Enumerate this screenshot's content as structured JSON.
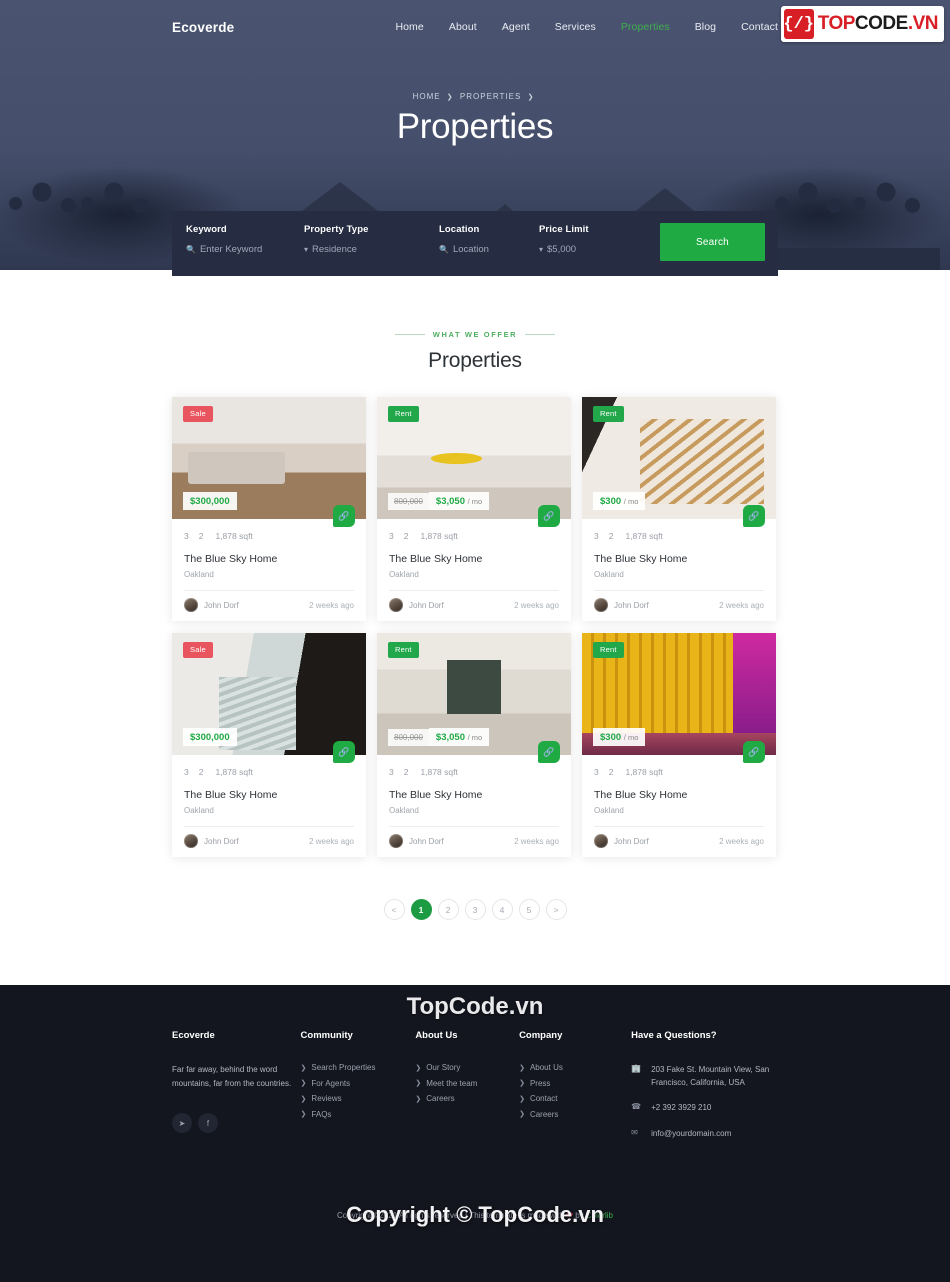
{
  "brand": "Ecoverde",
  "nav": {
    "items": [
      {
        "label": "Home",
        "active": false
      },
      {
        "label": "About",
        "active": false
      },
      {
        "label": "Agent",
        "active": false
      },
      {
        "label": "Services",
        "active": false
      },
      {
        "label": "Properties",
        "active": true
      },
      {
        "label": "Blog",
        "active": false
      },
      {
        "label": "Contact",
        "active": false
      }
    ]
  },
  "hero": {
    "breadcrumb": [
      "HOME",
      "PROPERTIES"
    ],
    "title": "Properties"
  },
  "search": {
    "keyword_label": "Keyword",
    "keyword_value": "Enter Keyword",
    "property_type_label": "Property Type",
    "property_type_value": "Residence",
    "location_label": "Location",
    "location_value": "Location",
    "price_label": "Price Limit",
    "price_value": "$5,000",
    "button": "Search"
  },
  "section": {
    "eyebrow": "WHAT WE OFFER",
    "title": "Properties"
  },
  "cards": [
    {
      "tag": "Sale",
      "tag_type": "sale",
      "price_old": "",
      "price_new": "$300,000",
      "per": "",
      "beds": "3",
      "baths": "2",
      "area": "1,878 sqft",
      "title": "The Blue Sky Home",
      "location": "Oakland",
      "author": "John Dorf",
      "ago": "2 weeks ago",
      "photo": "ph1"
    },
    {
      "tag": "Rent",
      "tag_type": "rent",
      "price_old": "800,000",
      "price_new": "$3,050",
      "per": "/ mo",
      "beds": "3",
      "baths": "2",
      "area": "1,878 sqft",
      "title": "The Blue Sky Home",
      "location": "Oakland",
      "author": "John Dorf",
      "ago": "2 weeks ago",
      "photo": "ph2"
    },
    {
      "tag": "Rent",
      "tag_type": "rent",
      "price_old": "",
      "price_new": "$300",
      "per": "/ mo",
      "beds": "3",
      "baths": "2",
      "area": "1,878 sqft",
      "title": "The Blue Sky Home",
      "location": "Oakland",
      "author": "John Dorf",
      "ago": "2 weeks ago",
      "photo": "ph3"
    },
    {
      "tag": "Sale",
      "tag_type": "sale",
      "price_old": "",
      "price_new": "$300,000",
      "per": "",
      "beds": "3",
      "baths": "2",
      "area": "1,878 sqft",
      "title": "The Blue Sky Home",
      "location": "Oakland",
      "author": "John Dorf",
      "ago": "2 weeks ago",
      "photo": "ph4"
    },
    {
      "tag": "Rent",
      "tag_type": "rent",
      "price_old": "800,000",
      "price_new": "$3,050",
      "per": "/ mo",
      "beds": "3",
      "baths": "2",
      "area": "1,878 sqft",
      "title": "The Blue Sky Home",
      "location": "Oakland",
      "author": "John Dorf",
      "ago": "2 weeks ago",
      "photo": "ph5"
    },
    {
      "tag": "Rent",
      "tag_type": "rent",
      "price_old": "",
      "price_new": "$300",
      "per": "/ mo",
      "beds": "3",
      "baths": "2",
      "area": "1,878 sqft",
      "title": "The Blue Sky Home",
      "location": "Oakland",
      "author": "John Dorf",
      "ago": "2 weeks ago",
      "photo": "ph6"
    }
  ],
  "pagination": {
    "prev": "<",
    "pages": [
      "1",
      "2",
      "3",
      "4",
      "5"
    ],
    "active": "1",
    "next": ">"
  },
  "footer": {
    "col1": {
      "title": "Ecoverde",
      "desc": "Far far away, behind the word mountains, far from the countries.",
      "socials": [
        "twitter-icon",
        "facebook-icon"
      ]
    },
    "col2": {
      "title": "Community",
      "links": [
        "Search Properties",
        "For Agents",
        "Reviews",
        "FAQs"
      ]
    },
    "col3": {
      "title": "About Us",
      "links": [
        "Our Story",
        "Meet the team",
        "Careers"
      ]
    },
    "col4": {
      "title": "Company",
      "links": [
        "About Us",
        "Press",
        "Contact",
        "Careers"
      ]
    },
    "col5": {
      "title": "Have a Questions?",
      "address": "203 Fake St. Mountain View, San Francisco, California, USA",
      "phone": "+2 392 3929 210",
      "email": "info@yourdomain.com"
    },
    "copyright_pre": "Copyright ©2021 All rights reserved | This template is made with ",
    "copyright_by": " by ",
    "copyright_link": "Colorlib"
  },
  "watermark": {
    "logo_brace": "{/}",
    "logo_t1": "TOP",
    "logo_t2": "CODE",
    "logo_t3": ".VN",
    "center": "TopCode.vn",
    "copy": "Copyright © TopCode.vn"
  }
}
